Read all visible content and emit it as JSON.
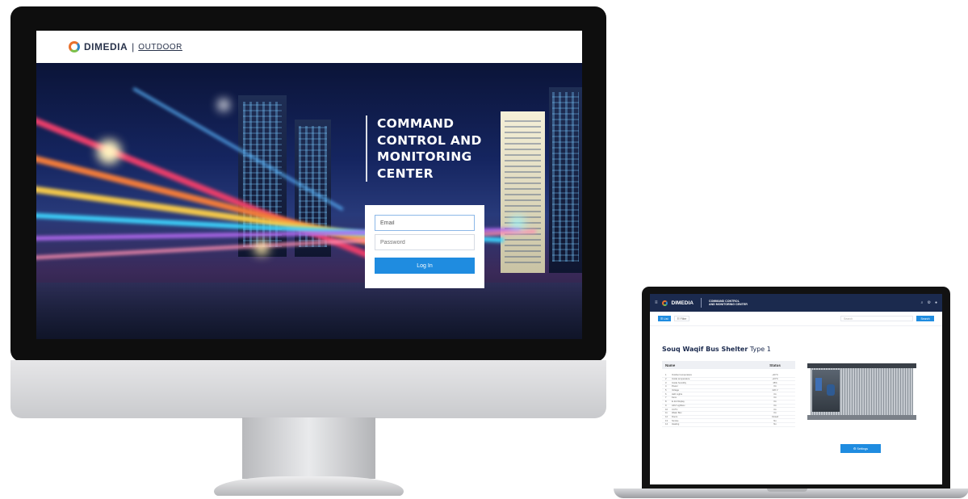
{
  "desktop": {
    "logo": {
      "brand": "DIMEDIA",
      "separator": "|",
      "sub": "OUTDOOR"
    },
    "hero_title": [
      "COMMAND",
      "CONTROL AND",
      "MONITORING",
      "CENTER"
    ],
    "login": {
      "email_value": "Email",
      "password_placeholder": "Password",
      "login_label": "Log In"
    }
  },
  "laptop": {
    "app_bar": {
      "menu_icon": "≡",
      "logo_text": "DIMEDIA",
      "title_line1": "COMMAND CONTROL",
      "title_line2": "AND MONITORING CENTER",
      "icons": [
        "search-icon",
        "gear-icon",
        "user-icon"
      ]
    },
    "toolbar": {
      "list_label": "☰ List",
      "filter_label": "☷ Filter",
      "search_placeholder": "Search",
      "search_label": "Search"
    },
    "heading": {
      "name": "Souq Waqif Bus Shelter",
      "type": "Type 1"
    },
    "table": {
      "headers": {
        "name": "Name",
        "status": "Status"
      },
      "rows": [
        {
          "no": "1",
          "name": "Outdoor temperature",
          "status": "+30°C"
        },
        {
          "no": "2",
          "name": "Inside temperature",
          "status": "+23°C"
        },
        {
          "no": "3",
          "name": "Inside humidity",
          "status": "45%"
        },
        {
          "no": "4",
          "name": "Power",
          "status": "On"
        },
        {
          "no": "5",
          "name": "Voltage",
          "status": "220 V"
        },
        {
          "no": "6",
          "name": "LED Lights",
          "status": "On"
        },
        {
          "no": "7",
          "name": "Fans",
          "status": "On"
        },
        {
          "no": "8",
          "name": "E-Ink Display",
          "status": "On"
        },
        {
          "no": "9",
          "name": "ADV Lightbox",
          "status": "On"
        },
        {
          "no": "10",
          "name": "CCTV",
          "status": "On"
        },
        {
          "no": "11",
          "name": "Water Box",
          "status": "On"
        },
        {
          "no": "12",
          "name": "Doors",
          "status": "Closed"
        },
        {
          "no": "13",
          "name": "Smoke",
          "status": "No"
        },
        {
          "no": "14",
          "name": "Heating",
          "status": "No"
        }
      ]
    },
    "settings_label": "⚙ Settings"
  }
}
